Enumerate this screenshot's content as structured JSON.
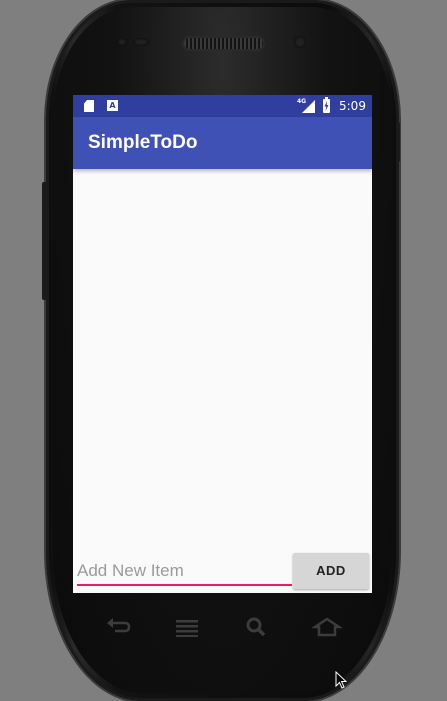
{
  "status_bar": {
    "time": "5:09",
    "network": "4G"
  },
  "app_bar": {
    "title": "SimpleToDo"
  },
  "items": [],
  "new_item": {
    "placeholder": "Add New Item",
    "value": ""
  },
  "add_button": {
    "label": "ADD"
  },
  "colors": {
    "status_bar": "#303f9f",
    "app_bar": "#3f51b5",
    "accent": "#e91e63"
  }
}
